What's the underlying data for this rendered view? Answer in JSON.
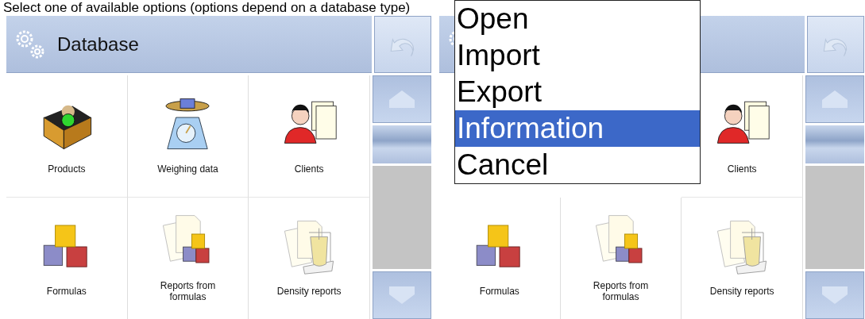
{
  "caption": "Select one of available options (options depend on a database type)",
  "screens": [
    {
      "title": "Database",
      "tiles": [
        {
          "label": "Products",
          "kind": "box"
        },
        {
          "label": "Weighing data",
          "kind": "scale"
        },
        {
          "label": "Clients",
          "kind": "client"
        },
        {
          "label": "Formulas",
          "kind": "blocks"
        },
        {
          "label": "Reports from formulas",
          "kind": "formula-report"
        },
        {
          "label": "Density reports",
          "kind": "density-report"
        }
      ]
    },
    {
      "menu": [
        {
          "label": "Open",
          "selected": false
        },
        {
          "label": "Import",
          "selected": false
        },
        {
          "label": "Export",
          "selected": false
        },
        {
          "label": "Information",
          "selected": true
        },
        {
          "label": "Cancel",
          "selected": false
        }
      ],
      "tiles": [
        {
          "label": "Clients",
          "kind": "client"
        },
        {
          "label": "Formulas",
          "kind": "blocks"
        },
        {
          "label": "Reports from formulas",
          "kind": "formula-report"
        },
        {
          "label": "Density reports",
          "kind": "density-report"
        }
      ]
    }
  ]
}
